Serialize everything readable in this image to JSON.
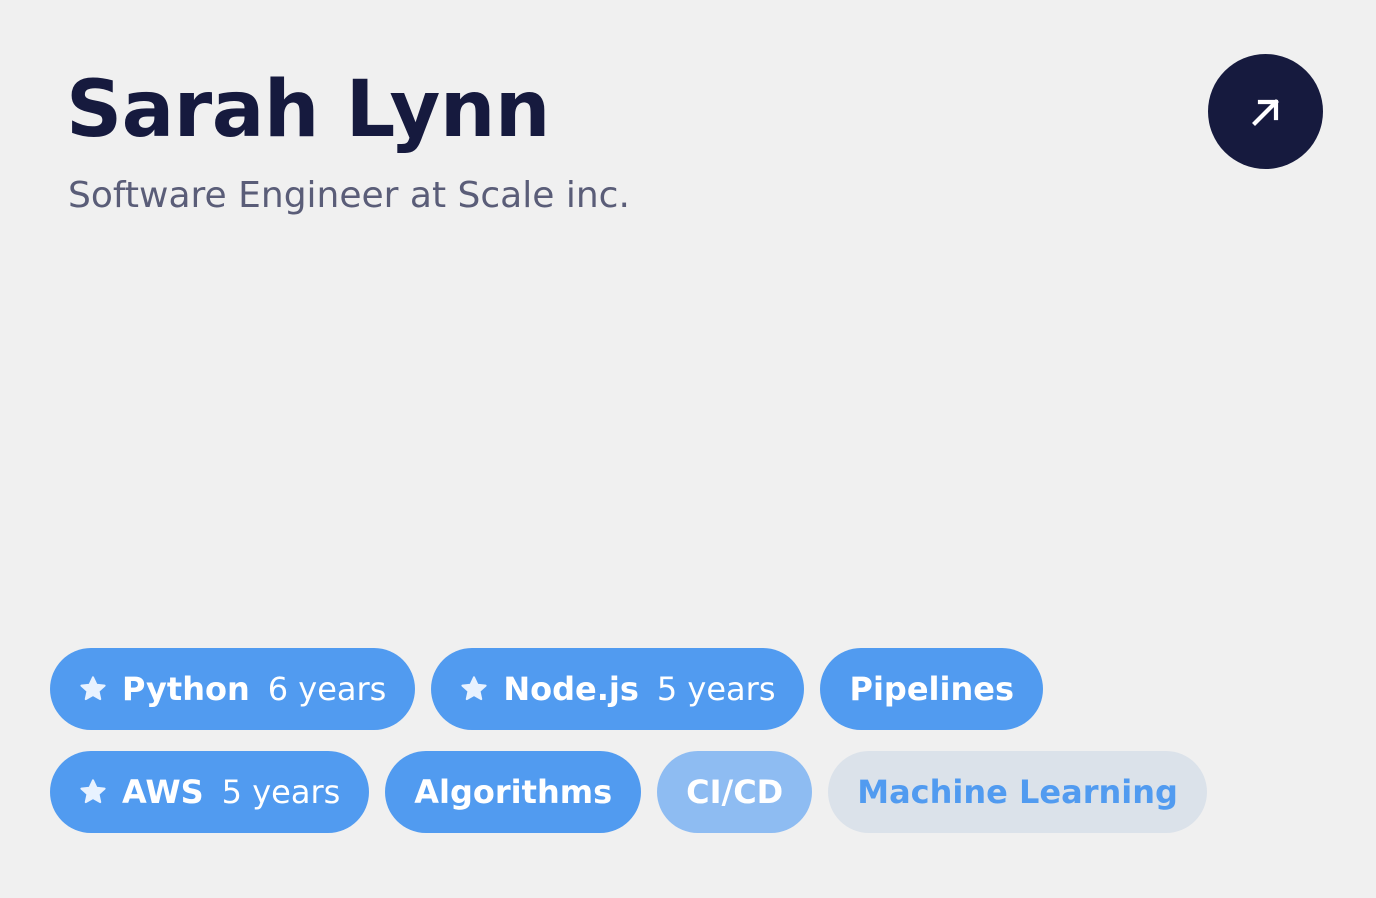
{
  "profile": {
    "name": "Sarah Lynn",
    "subtitle": "Software Engineer at Scale inc.",
    "open_icon": "arrow-up-right-icon"
  },
  "colors": {
    "background": "#f0f0f0",
    "heading": "#161a3e",
    "subtitle": "#5a5d78",
    "chip_primary": "#519bf0",
    "chip_secondary": "#8ebcf2",
    "chip_tertiary": "#dbe2ea"
  },
  "skills": {
    "rows": [
      [
        {
          "label": "Python",
          "years": "6 years",
          "starred": true,
          "style": "primary"
        },
        {
          "label": "Node.js",
          "years": "5 years",
          "starred": true,
          "style": "primary"
        },
        {
          "label": "Pipelines",
          "years": "",
          "starred": false,
          "style": "primary"
        }
      ],
      [
        {
          "label": "AWS",
          "years": "5 years",
          "starred": true,
          "style": "primary"
        },
        {
          "label": "Algorithms",
          "years": "",
          "starred": false,
          "style": "primary"
        },
        {
          "label": "CI/CD",
          "years": "",
          "starred": false,
          "style": "secondary"
        },
        {
          "label": "Machine Learning",
          "years": "",
          "starred": false,
          "style": "tertiary"
        }
      ]
    ]
  }
}
